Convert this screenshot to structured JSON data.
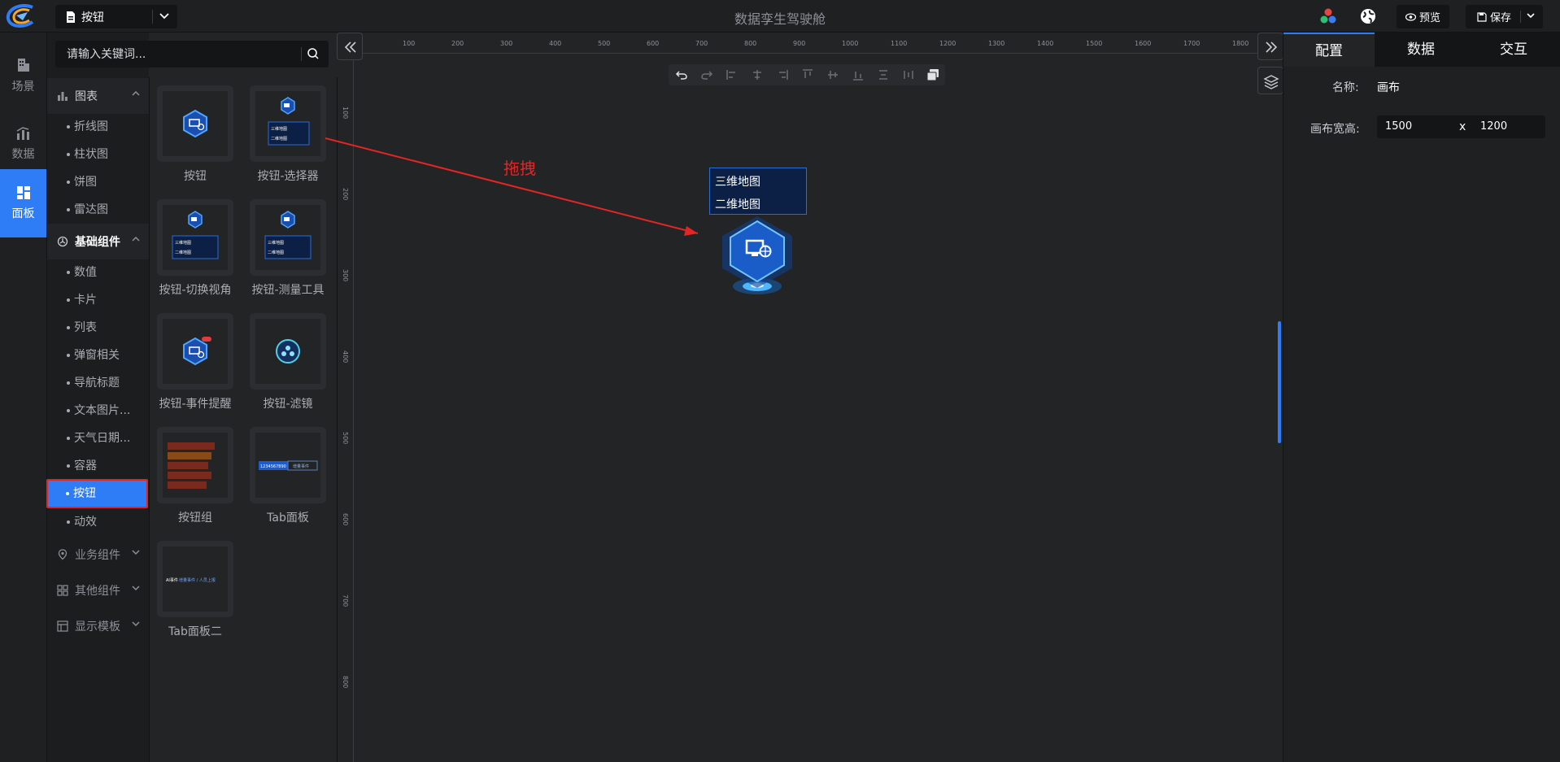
{
  "app": {
    "title": "数据孪生驾驶舱"
  },
  "page_select": {
    "value": "按钮"
  },
  "toolbar": {
    "preview_label": "预览",
    "save_label": "保存"
  },
  "left_nav": [
    {
      "label": "场景",
      "icon": "scene-icon"
    },
    {
      "label": "数据",
      "icon": "data-chart-icon"
    },
    {
      "label": "面板",
      "icon": "panel-grid-icon",
      "active": true
    }
  ],
  "search": {
    "placeholder": "请输入关键词..."
  },
  "categories": {
    "chart": {
      "label": "图表",
      "items": [
        "折线图",
        "柱状图",
        "饼图",
        "雷达图"
      ]
    },
    "basic": {
      "label": "基础组件",
      "items": [
        "数值",
        "卡片",
        "列表",
        "弹窗相关",
        "导航标题",
        "文本图片...",
        "天气日期...",
        "容器",
        "按钮",
        "动效"
      ],
      "selected": "按钮"
    },
    "business": {
      "label": "业务组件"
    },
    "other": {
      "label": "其他组件"
    },
    "template": {
      "label": "显示模板"
    }
  },
  "components": [
    {
      "label": "按钮"
    },
    {
      "label": "按钮-选择器"
    },
    {
      "label": "按钮-切换视角"
    },
    {
      "label": "按钮-测量工具"
    },
    {
      "label": "按钮-事件提醒"
    },
    {
      "label": "按钮-滤镜"
    },
    {
      "label": "按钮组"
    },
    {
      "label": "Tab面板"
    },
    {
      "label": "Tab面板二"
    }
  ],
  "thumb_text": {
    "map3d": "三维地图",
    "map2d": "二维地图",
    "tab1": "1234567890",
    "tab1b": "增量事件",
    "tab2": "AI事件",
    "tab2b": "增量事件 / 人员上报"
  },
  "ruler": {
    "h": [
      "100",
      "200",
      "300",
      "400",
      "500",
      "600",
      "700",
      "800",
      "900",
      "1000",
      "1100",
      "1200",
      "1300",
      "1400",
      "1500",
      "1600",
      "1700",
      "1800"
    ],
    "v": [
      "100",
      "200",
      "300",
      "400",
      "500",
      "600",
      "700",
      "800"
    ]
  },
  "canvas": {
    "drag_hint": "拖拽",
    "selector_options": [
      "三维地图",
      "二维地图"
    ]
  },
  "right_panel": {
    "tabs": [
      "配置",
      "数据",
      "交互"
    ],
    "name_label": "名称:",
    "name_value": "画布",
    "size_label": "画布宽高:",
    "width": "1500",
    "x_sep": "x",
    "height": "1200"
  },
  "colors": {
    "accent": "#2e7cf6",
    "highlight": "#e02323",
    "bg": "#232425"
  }
}
